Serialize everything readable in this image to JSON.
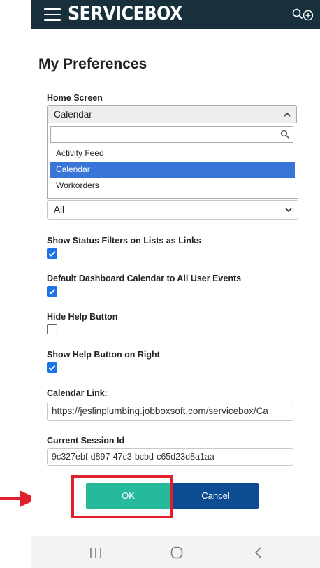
{
  "app": {
    "brand": "SERVICEBOX"
  },
  "page": {
    "title": "My Preferences"
  },
  "home_screen": {
    "label": "Home Screen",
    "value": "Calendar",
    "search_value": "",
    "options": [
      "Activity Feed",
      "Calendar",
      "Workorders"
    ],
    "selected_option": "Calendar"
  },
  "second_select": {
    "value": "All"
  },
  "checkboxes": [
    {
      "label": "Show Status Filters on Lists as Links",
      "checked": true
    },
    {
      "label": "Default Dashboard Calendar to All User Events",
      "checked": true
    },
    {
      "label": "Hide Help Button",
      "checked": false
    },
    {
      "label": "Show Help Button on Right",
      "checked": true
    }
  ],
  "calendar_link": {
    "label": "Calendar Link:",
    "value": "https://jeslinplumbing.jobboxsoft.com/servicebox/Ca"
  },
  "session": {
    "label": "Current Session Id",
    "value": "9c327ebf-d897-47c3-bcbd-c65d23d8a1aa"
  },
  "buttons": {
    "ok": "OK",
    "cancel": "Cancel"
  },
  "colors": {
    "topbar": "#17303b",
    "ok": "#26b99a",
    "cancel": "#0c4c92",
    "selected_option": "#3875d7",
    "checkbox": "#1a73e8",
    "annotation": "#e0202a"
  }
}
